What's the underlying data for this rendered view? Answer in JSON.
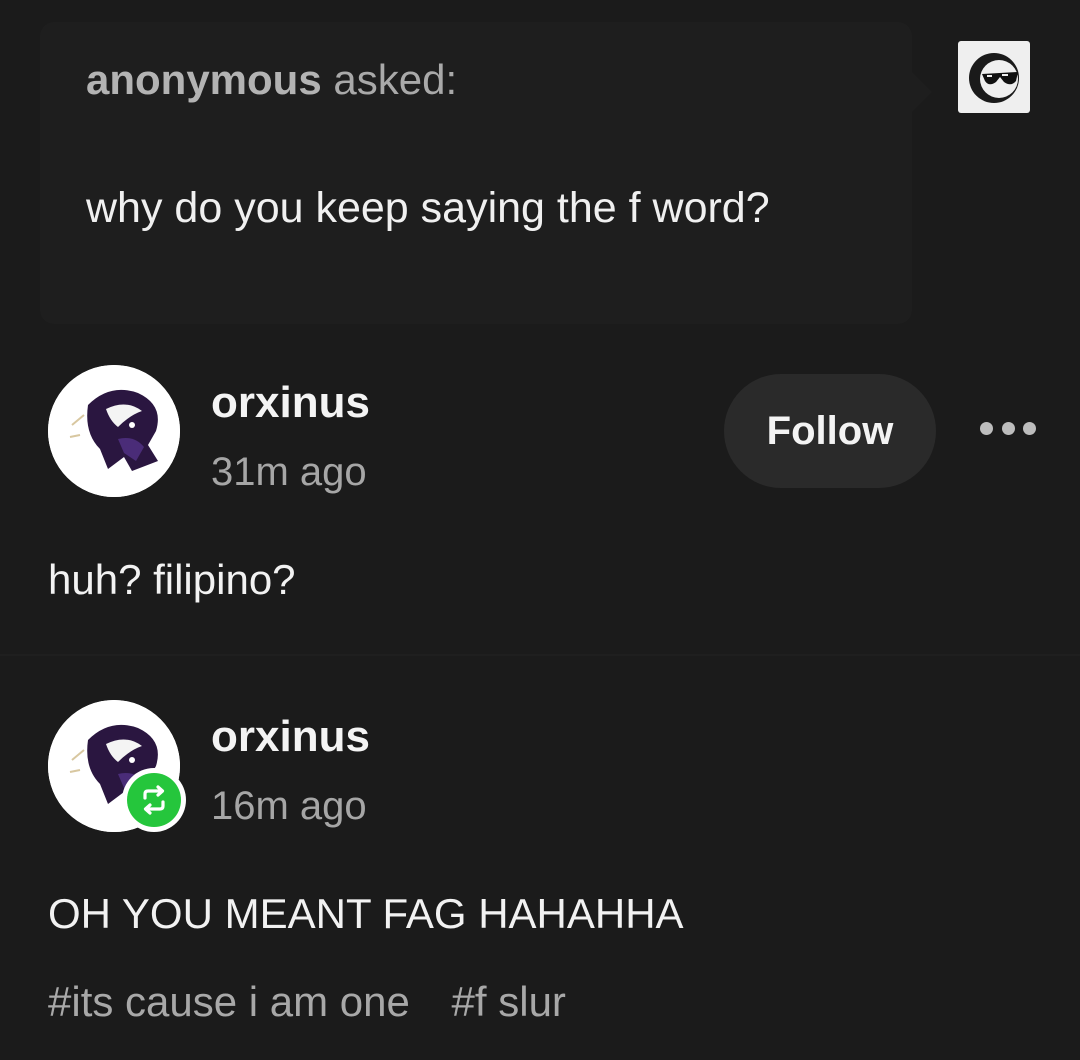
{
  "ask": {
    "asker_name": "anonymous",
    "asked_label": " asked:",
    "question": "why do you keep saying the f word?",
    "avatar_icon": "sunglasses-face-icon"
  },
  "post": {
    "username": "orxinus",
    "time": "31m ago",
    "follow_label": "Follow",
    "more_icon": "more-dots-icon",
    "body": "huh? filipino?"
  },
  "reblog": {
    "username": "orxinus",
    "time": "16m ago",
    "badge_icon": "reblog-icon",
    "badge_color": "#25c63c",
    "body": "OH YOU MEANT FAG HAHAHHA",
    "tags": [
      "#its cause i am one",
      "#f slur"
    ]
  }
}
